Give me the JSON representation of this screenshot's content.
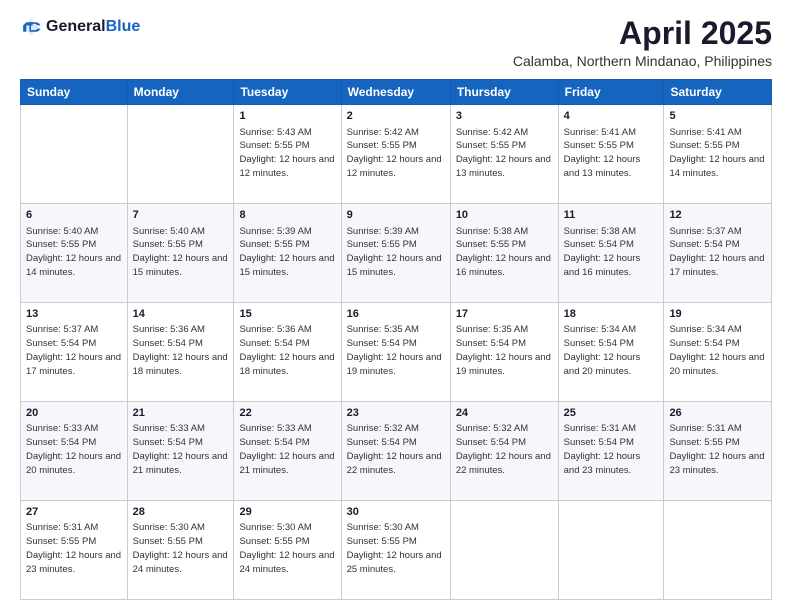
{
  "header": {
    "logo_general": "General",
    "logo_blue": "Blue",
    "month_title": "April 2025",
    "location": "Calamba, Northern Mindanao, Philippines"
  },
  "columns": [
    "Sunday",
    "Monday",
    "Tuesday",
    "Wednesday",
    "Thursday",
    "Friday",
    "Saturday"
  ],
  "weeks": [
    [
      {
        "day": "",
        "info": ""
      },
      {
        "day": "",
        "info": ""
      },
      {
        "day": "1",
        "info": "Sunrise: 5:43 AM\nSunset: 5:55 PM\nDaylight: 12 hours\nand 12 minutes."
      },
      {
        "day": "2",
        "info": "Sunrise: 5:42 AM\nSunset: 5:55 PM\nDaylight: 12 hours\nand 12 minutes."
      },
      {
        "day": "3",
        "info": "Sunrise: 5:42 AM\nSunset: 5:55 PM\nDaylight: 12 hours\nand 13 minutes."
      },
      {
        "day": "4",
        "info": "Sunrise: 5:41 AM\nSunset: 5:55 PM\nDaylight: 12 hours\nand 13 minutes."
      },
      {
        "day": "5",
        "info": "Sunrise: 5:41 AM\nSunset: 5:55 PM\nDaylight: 12 hours\nand 14 minutes."
      }
    ],
    [
      {
        "day": "6",
        "info": "Sunrise: 5:40 AM\nSunset: 5:55 PM\nDaylight: 12 hours\nand 14 minutes."
      },
      {
        "day": "7",
        "info": "Sunrise: 5:40 AM\nSunset: 5:55 PM\nDaylight: 12 hours\nand 15 minutes."
      },
      {
        "day": "8",
        "info": "Sunrise: 5:39 AM\nSunset: 5:55 PM\nDaylight: 12 hours\nand 15 minutes."
      },
      {
        "day": "9",
        "info": "Sunrise: 5:39 AM\nSunset: 5:55 PM\nDaylight: 12 hours\nand 15 minutes."
      },
      {
        "day": "10",
        "info": "Sunrise: 5:38 AM\nSunset: 5:55 PM\nDaylight: 12 hours\nand 16 minutes."
      },
      {
        "day": "11",
        "info": "Sunrise: 5:38 AM\nSunset: 5:54 PM\nDaylight: 12 hours\nand 16 minutes."
      },
      {
        "day": "12",
        "info": "Sunrise: 5:37 AM\nSunset: 5:54 PM\nDaylight: 12 hours\nand 17 minutes."
      }
    ],
    [
      {
        "day": "13",
        "info": "Sunrise: 5:37 AM\nSunset: 5:54 PM\nDaylight: 12 hours\nand 17 minutes."
      },
      {
        "day": "14",
        "info": "Sunrise: 5:36 AM\nSunset: 5:54 PM\nDaylight: 12 hours\nand 18 minutes."
      },
      {
        "day": "15",
        "info": "Sunrise: 5:36 AM\nSunset: 5:54 PM\nDaylight: 12 hours\nand 18 minutes."
      },
      {
        "day": "16",
        "info": "Sunrise: 5:35 AM\nSunset: 5:54 PM\nDaylight: 12 hours\nand 19 minutes."
      },
      {
        "day": "17",
        "info": "Sunrise: 5:35 AM\nSunset: 5:54 PM\nDaylight: 12 hours\nand 19 minutes."
      },
      {
        "day": "18",
        "info": "Sunrise: 5:34 AM\nSunset: 5:54 PM\nDaylight: 12 hours\nand 20 minutes."
      },
      {
        "day": "19",
        "info": "Sunrise: 5:34 AM\nSunset: 5:54 PM\nDaylight: 12 hours\nand 20 minutes."
      }
    ],
    [
      {
        "day": "20",
        "info": "Sunrise: 5:33 AM\nSunset: 5:54 PM\nDaylight: 12 hours\nand 20 minutes."
      },
      {
        "day": "21",
        "info": "Sunrise: 5:33 AM\nSunset: 5:54 PM\nDaylight: 12 hours\nand 21 minutes."
      },
      {
        "day": "22",
        "info": "Sunrise: 5:33 AM\nSunset: 5:54 PM\nDaylight: 12 hours\nand 21 minutes."
      },
      {
        "day": "23",
        "info": "Sunrise: 5:32 AM\nSunset: 5:54 PM\nDaylight: 12 hours\nand 22 minutes."
      },
      {
        "day": "24",
        "info": "Sunrise: 5:32 AM\nSunset: 5:54 PM\nDaylight: 12 hours\nand 22 minutes."
      },
      {
        "day": "25",
        "info": "Sunrise: 5:31 AM\nSunset: 5:54 PM\nDaylight: 12 hours\nand 23 minutes."
      },
      {
        "day": "26",
        "info": "Sunrise: 5:31 AM\nSunset: 5:55 PM\nDaylight: 12 hours\nand 23 minutes."
      }
    ],
    [
      {
        "day": "27",
        "info": "Sunrise: 5:31 AM\nSunset: 5:55 PM\nDaylight: 12 hours\nand 23 minutes."
      },
      {
        "day": "28",
        "info": "Sunrise: 5:30 AM\nSunset: 5:55 PM\nDaylight: 12 hours\nand 24 minutes."
      },
      {
        "day": "29",
        "info": "Sunrise: 5:30 AM\nSunset: 5:55 PM\nDaylight: 12 hours\nand 24 minutes."
      },
      {
        "day": "30",
        "info": "Sunrise: 5:30 AM\nSunset: 5:55 PM\nDaylight: 12 hours\nand 25 minutes."
      },
      {
        "day": "",
        "info": ""
      },
      {
        "day": "",
        "info": ""
      },
      {
        "day": "",
        "info": ""
      }
    ]
  ]
}
